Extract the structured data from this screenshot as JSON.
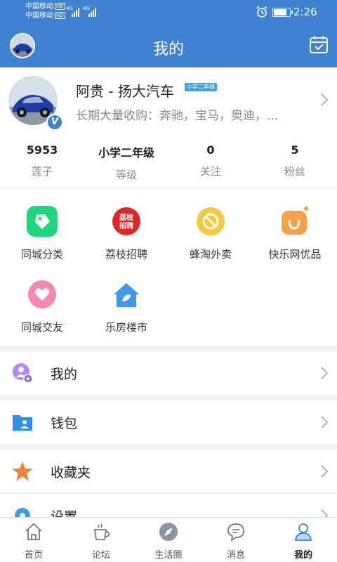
{
  "statusbar": {
    "carrier1": "中国移动",
    "carrier2": "中国移动",
    "hd": "HD",
    "net1": "4G",
    "net2": "4G",
    "time": "2:26"
  },
  "header": {
    "title": "我的"
  },
  "profile": {
    "name": "阿贵 - 扬大汽车",
    "level_badge": "小学二年级",
    "signature": "长期大量收购：奔驰，宝马，奥迪，...",
    "verified_mark": "V"
  },
  "stats": [
    {
      "value": "5953",
      "label": "莲子"
    },
    {
      "value": "小学二年级",
      "label": "等级"
    },
    {
      "value": "0",
      "label": "关注"
    },
    {
      "value": "5",
      "label": "粉丝"
    }
  ],
  "services": [
    {
      "label": "同城分类",
      "icon": "tag-icon",
      "color": "#1fd67e"
    },
    {
      "label": "荔枝招聘",
      "icon": "recruit-logo-icon",
      "color": "#e02727",
      "logo_text": "荔枝招聘"
    },
    {
      "label": "蜂淘外卖",
      "icon": "no-sign-icon",
      "color": "#f9c83c"
    },
    {
      "label": "快乐网优品",
      "icon": "shopping-bag-icon",
      "color": "#f7a045"
    },
    {
      "label": "同城交友",
      "icon": "heart-icon",
      "color": "#f58ab0"
    },
    {
      "label": "乐房楼市",
      "icon": "house-icon",
      "color": "#3e9ae8"
    }
  ],
  "menu": [
    {
      "label": "我的",
      "icon": "user-bubble-icon"
    },
    {
      "label": "钱包",
      "icon": "wallet-folder-icon"
    },
    {
      "label": "收藏夹",
      "icon": "star-icon"
    },
    {
      "label": "设置",
      "icon": "gear-icon"
    }
  ],
  "tabs": [
    {
      "label": "首页",
      "icon": "home-icon",
      "active": false
    },
    {
      "label": "论坛",
      "icon": "coffee-cup-icon",
      "active": false
    },
    {
      "label": "生活圈",
      "icon": "compass-icon",
      "active": false
    },
    {
      "label": "消息",
      "icon": "chat-bubble-icon",
      "active": false
    },
    {
      "label": "我的",
      "icon": "person-icon",
      "active": true
    }
  ],
  "colors": {
    "brand_blue": "#3f82d1"
  }
}
